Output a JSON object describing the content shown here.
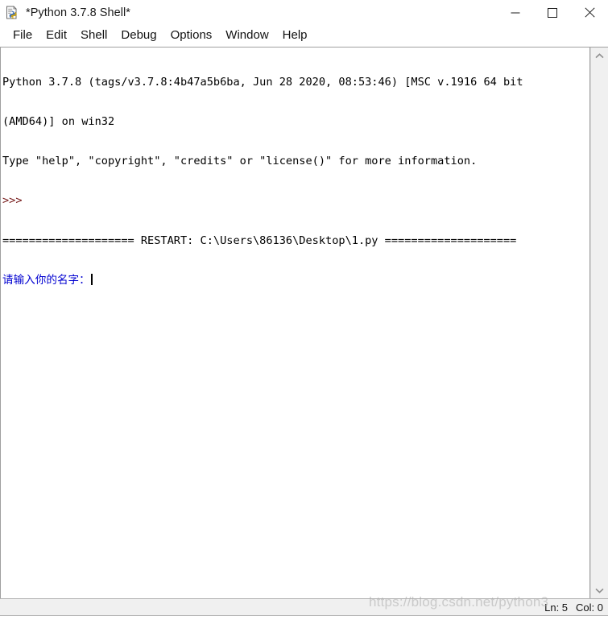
{
  "window": {
    "title": "*Python 3.7.8 Shell*",
    "icon": "python-idle-icon",
    "controls": {
      "minimize_label": "Minimize",
      "maximize_label": "Maximize",
      "close_label": "Close"
    }
  },
  "menu": {
    "items": [
      {
        "label": "File"
      },
      {
        "label": "Edit"
      },
      {
        "label": "Shell"
      },
      {
        "label": "Debug"
      },
      {
        "label": "Options"
      },
      {
        "label": "Window"
      },
      {
        "label": "Help"
      }
    ]
  },
  "console": {
    "lines": [
      {
        "text": "Python 3.7.8 (tags/v3.7.8:4b47a5b6ba, Jun 28 2020, 08:53:46) [MSC v.1916 64 bit",
        "color": "black"
      },
      {
        "text": "(AMD64)] on win32",
        "color": "black"
      },
      {
        "text": "Type \"help\", \"copyright\", \"credits\" or \"license()\" for more information.",
        "color": "black"
      },
      {
        "text": ">>>",
        "color": "prompt"
      },
      {
        "text": "==================== RESTART: C:\\Users\\86136\\Desktop\\1.py ====================",
        "color": "black"
      },
      {
        "text": "请输入你的名字：",
        "color": "blue",
        "caret": true
      }
    ]
  },
  "scrollbar": {
    "up_arrow": "chevron-up-icon",
    "down_arrow": "chevron-down-icon"
  },
  "status_bar": {
    "line_label": "Ln: 5",
    "col_label": "Col: 0"
  },
  "watermark": {
    "text": "https://blog.csdn.net/python3"
  },
  "colors": {
    "prompt": "#7a2020",
    "input_text": "#0000d0",
    "output_text": "#000000",
    "chrome": "#f0f0f0"
  }
}
